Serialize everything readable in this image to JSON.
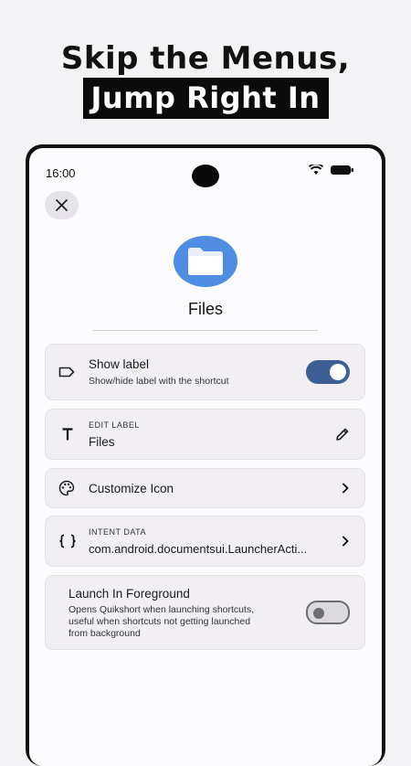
{
  "promo": {
    "line1": "Skip the Menus,",
    "line2": "Jump Right In"
  },
  "status_bar": {
    "time": "16:00"
  },
  "app": {
    "name": "Files",
    "icon": "folder-icon",
    "icon_color": "#4e8de1"
  },
  "settings": {
    "show_label": {
      "title": "Show label",
      "subtitle": "Show/hide label with the shortcut",
      "enabled": true,
      "toggle_color": "#3d5f95"
    },
    "edit_label": {
      "overline": "EDIT LABEL",
      "value": "Files"
    },
    "customize_icon": {
      "title": "Customize Icon"
    },
    "intent_data": {
      "overline": "INTENT DATA",
      "value": "com.android.documentsui.LauncherActi..."
    },
    "launch_foreground": {
      "title": "Launch In Foreground",
      "subtitle_line1": "Opens Quikshort when launching shortcuts,",
      "subtitle_line2": "useful when shortcuts not getting launched",
      "subtitle_line3": "from background",
      "enabled": false
    }
  }
}
